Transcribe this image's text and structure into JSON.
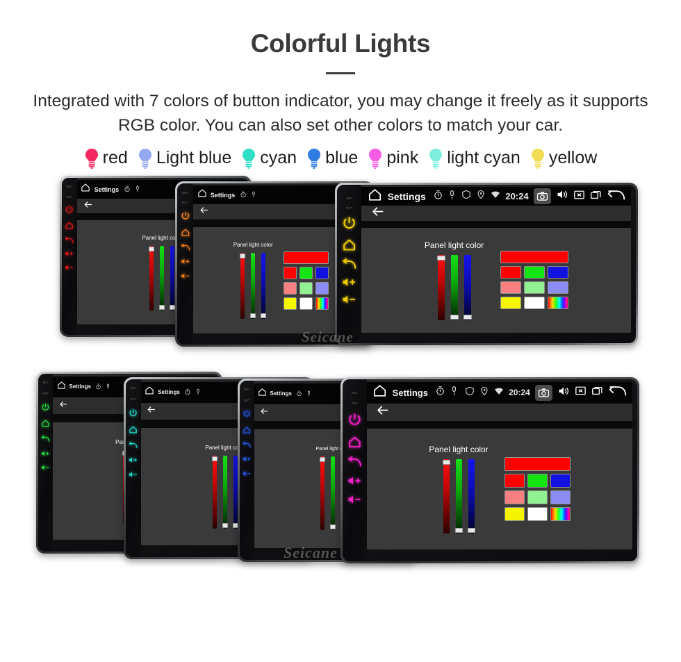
{
  "header": {
    "title": "Colorful Lights",
    "subtitle": "Integrated with 7 colors of button indicator, you may change it freely as it supports RGB color. You can also set other colors to match your car."
  },
  "legend": {
    "items": [
      {
        "label": "red",
        "color": "#F4285F",
        "icon": "bulb-icon"
      },
      {
        "label": "Light blue",
        "color": "#93AAF2",
        "icon": "bulb-icon"
      },
      {
        "label": "cyan",
        "color": "#2FDFC7",
        "icon": "bulb-icon"
      },
      {
        "label": "blue",
        "color": "#2E7BE2",
        "icon": "bulb-icon"
      },
      {
        "label": "pink",
        "color": "#F75CE4",
        "icon": "bulb-icon"
      },
      {
        "label": "light cyan",
        "color": "#7FEDDD",
        "icon": "bulb-icon"
      },
      {
        "label": "yellow",
        "color": "#F2DC55",
        "icon": "bulb-icon"
      }
    ]
  },
  "screen_ui": {
    "status_title": "Settings",
    "clock": "20:24",
    "panel_label": "Panel light color",
    "icons": {
      "home": "home-icon",
      "timer": "timer-icon",
      "mic": "mic-pin-icon",
      "shield": "shield-icon",
      "location": "location-pin-icon",
      "wifi": "wifi-icon",
      "camera": "camera-icon",
      "volume": "volume-icon",
      "close": "close-box-icon",
      "recents": "recents-icon",
      "back": "back-arrow-icon",
      "action_back": "back-arrow-icon"
    },
    "bezel": {
      "mic_label": "MIC",
      "rst_label": "RST",
      "buttons": [
        "power-button",
        "home-button",
        "back-button",
        "volume-up-button",
        "volume-down-button"
      ]
    },
    "sliders": [
      {
        "name": "red-slider",
        "channel": "R",
        "value": 255,
        "thumb": "top"
      },
      {
        "name": "green-slider",
        "channel": "G",
        "value": 0,
        "thumb": "bottom"
      },
      {
        "name": "blue-slider",
        "channel": "B",
        "value": 0,
        "thumb": "bottom"
      }
    ],
    "preview_color": "#FF0000",
    "swatch_rows": [
      [
        {
          "name": "swatch-red",
          "color": "#FF0000"
        },
        {
          "name": "swatch-green",
          "color": "#12E512"
        },
        {
          "name": "swatch-blue",
          "color": "#1212E0"
        }
      ],
      [
        {
          "name": "swatch-salmon",
          "color": "#F98080"
        },
        {
          "name": "swatch-lightgreen",
          "color": "#90F290"
        },
        {
          "name": "swatch-periwinkle",
          "color": "#8C8CF5"
        }
      ],
      [
        {
          "name": "swatch-yellow",
          "color": "#F5F500"
        },
        {
          "name": "swatch-white",
          "color": "#FFFFFF"
        },
        {
          "name": "swatch-rainbow",
          "color": "rainbow"
        }
      ]
    ]
  },
  "devices": {
    "watermark": "Seicane",
    "top_row": [
      {
        "name": "device-red",
        "led_color": "#E01818",
        "reveal": "label-only"
      },
      {
        "name": "device-orange",
        "led_color": "#F08020",
        "reveal": "partial"
      },
      {
        "name": "device-yellow",
        "led_color": "#F2D000",
        "reveal": "full"
      }
    ],
    "bottom_row": [
      {
        "name": "device-green",
        "led_color": "#28DD45",
        "reveal": "slider-only"
      },
      {
        "name": "device-cyan",
        "led_color": "#22DCD0",
        "reveal": "sliders"
      },
      {
        "name": "device-blue",
        "led_color": "#2A5CF5",
        "reveal": "label-only"
      },
      {
        "name": "device-magenta",
        "led_color": "#F321C8",
        "reveal": "full"
      }
    ]
  }
}
